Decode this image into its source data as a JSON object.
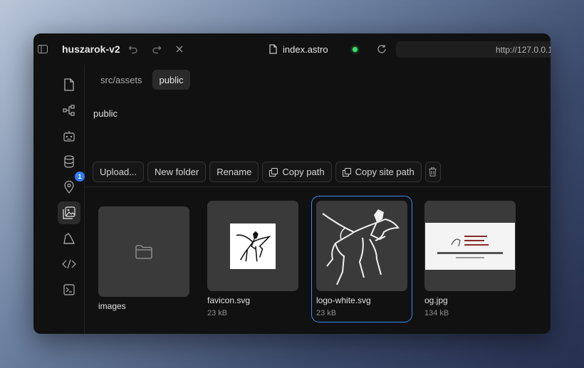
{
  "titlebar": {
    "project": "huszarok-v2",
    "file": "index.astro",
    "url": "http://127.0.0.1"
  },
  "rail": {
    "badge_count": "1"
  },
  "tabs": [
    {
      "label": "src/assets"
    },
    {
      "label": "public"
    }
  ],
  "breadcrumb": "public",
  "toolbar": {
    "upload": "Upload...",
    "new_folder": "New folder",
    "rename": "Rename",
    "copy_path": "Copy path",
    "copy_site_path": "Copy site path"
  },
  "files": [
    {
      "name": "images",
      "size": ""
    },
    {
      "name": "favicon.svg",
      "size": "23 kB"
    },
    {
      "name": "logo-white.svg",
      "size": "23 kB"
    },
    {
      "name": "og.jpg",
      "size": "134 kB"
    }
  ],
  "colors": {
    "accent": "#3b8ef5",
    "status_ok": "#3ddc6a",
    "badge": "#2f7cf6"
  }
}
